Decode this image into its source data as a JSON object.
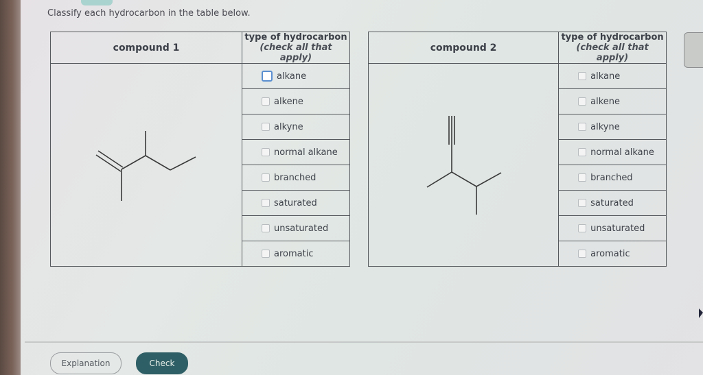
{
  "prompt": "Classify each hydrocarbon in the table below.",
  "type_header": {
    "title": "type of hydrocarbon",
    "subtitle": "(check all that apply)"
  },
  "compounds": [
    {
      "label": "compound 1",
      "structure": "3-methyl-2-methylpent-1-ene skeletal (C=C double bond with branching)",
      "options": [
        {
          "label": "alkane",
          "checked": false,
          "focused": true
        },
        {
          "label": "alkene",
          "checked": false
        },
        {
          "label": "alkyne",
          "checked": false
        },
        {
          "label": "normal alkane",
          "checked": false
        },
        {
          "label": "branched",
          "checked": false
        },
        {
          "label": "saturated",
          "checked": false
        },
        {
          "label": "unsaturated",
          "checked": false
        },
        {
          "label": "aromatic",
          "checked": false
        }
      ]
    },
    {
      "label": "compound 2",
      "structure": "terminal alkyne with branched chain skeletal",
      "options": [
        {
          "label": "alkane",
          "checked": false
        },
        {
          "label": "alkene",
          "checked": false
        },
        {
          "label": "alkyne",
          "checked": false
        },
        {
          "label": "normal alkane",
          "checked": false
        },
        {
          "label": "branched",
          "checked": false
        },
        {
          "label": "saturated",
          "checked": false
        },
        {
          "label": "unsaturated",
          "checked": false
        },
        {
          "label": "aromatic",
          "checked": false
        }
      ]
    }
  ],
  "buttons": {
    "explanation": "Explanation",
    "check": "Check"
  },
  "colors": {
    "check_button": "#2f5f66",
    "focus_checkbox": "#5a8fd0"
  }
}
